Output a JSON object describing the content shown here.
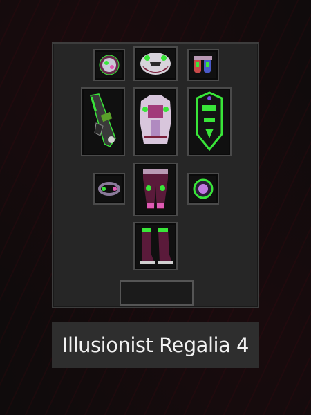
{
  "set": {
    "name": "Illusionist Regalia 4"
  },
  "slots": [
    {
      "name": "amulet",
      "icon": "amulet-icon"
    },
    {
      "name": "helmet",
      "icon": "helmet-icon"
    },
    {
      "name": "gloves",
      "icon": "gloves-icon"
    },
    {
      "name": "weapon",
      "icon": "gun-weapon-icon"
    },
    {
      "name": "chest",
      "icon": "chest-armor-icon"
    },
    {
      "name": "shield",
      "icon": "shield-icon"
    },
    {
      "name": "ring-left",
      "icon": "ring-icon"
    },
    {
      "name": "pants",
      "icon": "pants-icon"
    },
    {
      "name": "ring-right",
      "icon": "orb-ring-icon"
    },
    {
      "name": "boots",
      "icon": "boots-icon"
    }
  ],
  "colors": {
    "accent_green": "#39e639",
    "accent_pink": "#e05ab4",
    "panel": "#262626",
    "label_bg": "#2e2e2e"
  }
}
